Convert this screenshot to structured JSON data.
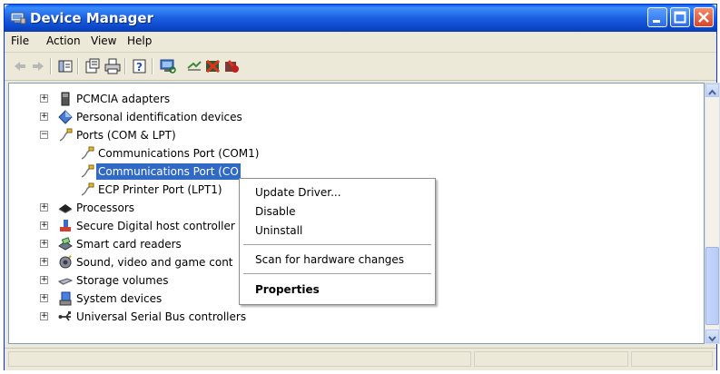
{
  "window": {
    "title": "Device Manager"
  },
  "menubar": {
    "items": [
      "File",
      "Action",
      "View",
      "Help"
    ]
  },
  "toolbar": {
    "icons": [
      "back-arrow-icon",
      "forward-arrow-icon",
      "show-hide-tree-icon",
      "properties-icon",
      "print-icon",
      "help-icon",
      "scan-hardware-icon",
      "update-driver-icon",
      "uninstall-icon",
      "disable-icon"
    ]
  },
  "tree": {
    "items": [
      {
        "label": "PCMCIA adapters",
        "expander": "+"
      },
      {
        "label": "Personal identification devices",
        "expander": "+"
      },
      {
        "label": "Ports (COM & LPT)",
        "expander": "−"
      },
      {
        "label": "Communications Port (COM1)"
      },
      {
        "label": "Communications Port (CO"
      },
      {
        "label": "ECP Printer Port (LPT1)"
      },
      {
        "label": "Processors",
        "expander": "+"
      },
      {
        "label": "Secure Digital host controller",
        "expander": "+"
      },
      {
        "label": "Smart card readers",
        "expander": "+"
      },
      {
        "label": "Sound, video and game cont",
        "expander": "+"
      },
      {
        "label": "Storage volumes",
        "expander": "+"
      },
      {
        "label": "System devices",
        "expander": "+"
      },
      {
        "label": "Universal Serial Bus controllers",
        "expander": "+"
      }
    ]
  },
  "context_menu": {
    "update_driver": "Update Driver...",
    "disable": "Disable",
    "uninstall": "Uninstall",
    "scan": "Scan for hardware changes",
    "properties": "Properties"
  },
  "colors": {
    "title_blue": "#0a5fe8",
    "selection": "#316ac5",
    "menu_bg": "#ece9d8"
  }
}
